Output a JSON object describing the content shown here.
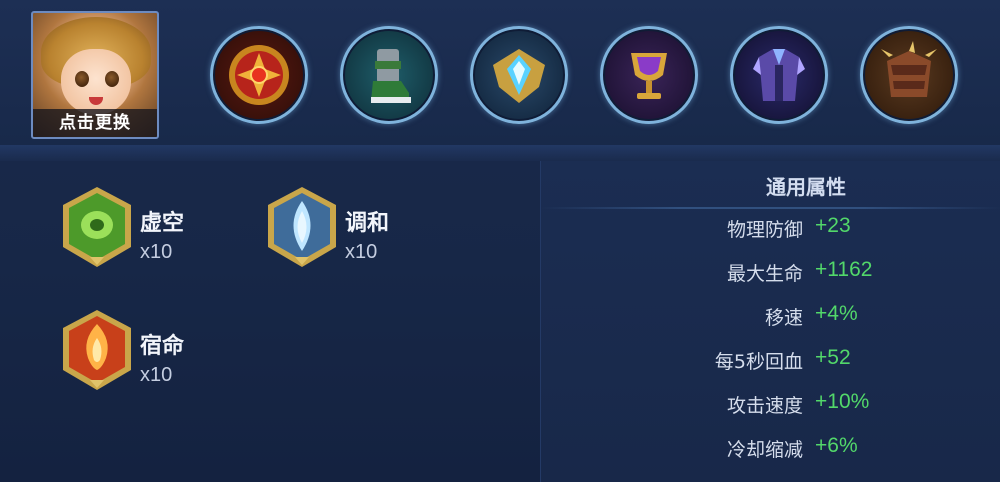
{
  "hero": {
    "change_label": "点击更换"
  },
  "equipment": [
    {
      "icon": "red-gear-emblem-icon",
      "ring_color": "#8fb8dc"
    },
    {
      "icon": "green-boots-icon",
      "ring_color": "#8fb8dc"
    },
    {
      "icon": "golden-shield-crystal-icon",
      "ring_color": "#8fb8dc"
    },
    {
      "icon": "golden-chalice-icon",
      "ring_color": "#8fb8dc"
    },
    {
      "icon": "purple-armor-icon",
      "ring_color": "#8fb8dc"
    },
    {
      "icon": "spiked-armor-icon",
      "ring_color": "#8fb8dc"
    }
  ],
  "runes": [
    {
      "name": "虚空",
      "count": "x10",
      "icon": "green-rune-icon",
      "color": "#5aa032"
    },
    {
      "name": "调和",
      "count": "x10",
      "icon": "blue-rune-icon",
      "color": "#7fb3d8"
    },
    {
      "name": "宿命",
      "count": "x10",
      "icon": "red-rune-icon",
      "color": "#d84a1e"
    }
  ],
  "stats": {
    "title": "通用属性",
    "rows": [
      {
        "label": "物理防御",
        "value": "+23"
      },
      {
        "label": "最大生命",
        "value": "+1162"
      },
      {
        "label": "移速",
        "value": "+4%"
      },
      {
        "label": "每5秒回血",
        "value": "+52"
      },
      {
        "label": "攻击速度",
        "value": "+10%"
      },
      {
        "label": "冷却缩减",
        "value": "+6%"
      }
    ],
    "value_color": "#52d86a"
  }
}
